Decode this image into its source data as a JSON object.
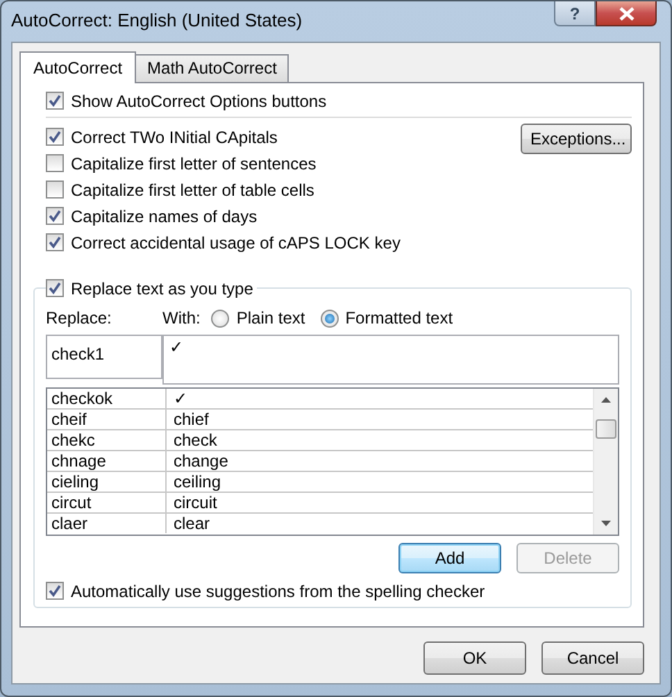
{
  "window": {
    "title": "AutoCorrect: English (United States)",
    "help_button": "?"
  },
  "tabs": [
    {
      "label": "AutoCorrect",
      "selected": true
    },
    {
      "label": "Math AutoCorrect",
      "selected": false
    }
  ],
  "options": [
    {
      "label": "Show AutoCorrect Options buttons",
      "checked": true
    },
    {
      "label": "Correct TWo INitial CApitals",
      "checked": true
    },
    {
      "label": "Capitalize first letter of sentences",
      "checked": false
    },
    {
      "label": "Capitalize first letter of table cells",
      "checked": false
    },
    {
      "label": "Capitalize names of days",
      "checked": true
    },
    {
      "label": "Correct accidental usage of cAPS LOCK key",
      "checked": true
    }
  ],
  "exceptions_button": "Exceptions...",
  "replace_group": {
    "checkbox": {
      "label": "Replace text as you type",
      "checked": true
    },
    "replace_label": "Replace:",
    "with_label": "With:",
    "format_options": [
      {
        "label": "Plain text",
        "selected": false
      },
      {
        "label": "Formatted text",
        "selected": true
      }
    ],
    "replace_value": "check1",
    "with_value": "✓",
    "entries": [
      {
        "replace": "checkok",
        "with": "✓"
      },
      {
        "replace": "cheif",
        "with": "chief"
      },
      {
        "replace": "chekc",
        "with": "check"
      },
      {
        "replace": "chnage",
        "with": "change"
      },
      {
        "replace": "cieling",
        "with": "ceiling"
      },
      {
        "replace": "circut",
        "with": "circuit"
      },
      {
        "replace": "claer",
        "with": "clear"
      }
    ],
    "add_button": {
      "label": "Add",
      "disabled": false,
      "focused": true
    },
    "delete_button": {
      "label": "Delete",
      "disabled": true,
      "focused": false
    },
    "spelling_checkbox": {
      "label": "Automatically use suggestions from the spelling checker",
      "checked": true
    }
  },
  "buttons": [
    {
      "label": "OK"
    },
    {
      "label": "Cancel"
    }
  ]
}
